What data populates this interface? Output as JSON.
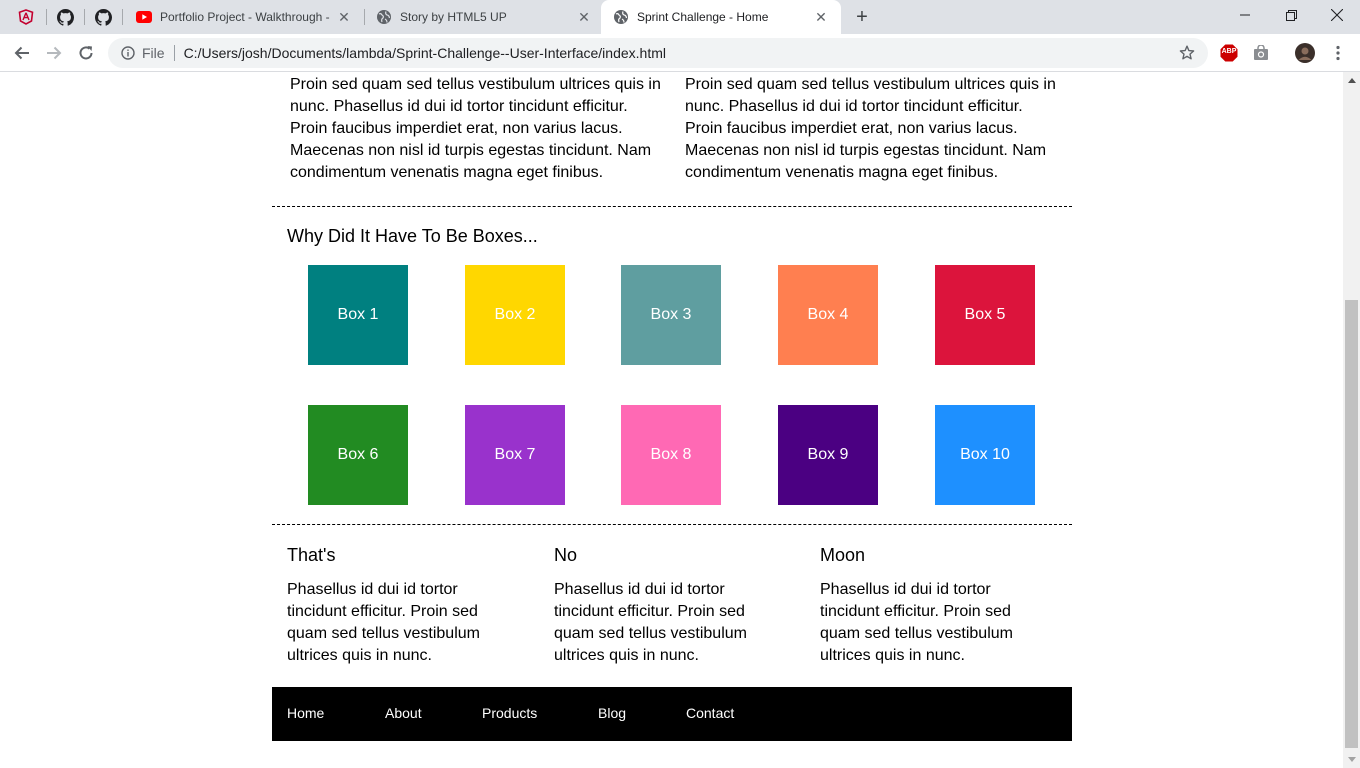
{
  "browser": {
    "tabs": [
      {
        "title": "Portfolio Project - Walkthrough -",
        "favicon": "youtube-icon"
      },
      {
        "title": "Story by HTML5 UP",
        "favicon": "globe-icon"
      },
      {
        "title": "Sprint Challenge - Home",
        "favicon": "globe-icon",
        "active": true
      }
    ],
    "pinned_tabs": [
      "angular-icon",
      "github-icon",
      "github-icon"
    ],
    "address": {
      "scheme_label": "File",
      "url": "C:/Users/josh/Documents/lambda/Sprint-Challenge--User-Interface/index.html"
    },
    "extensions": {
      "adblock_label": "ABP"
    }
  },
  "page": {
    "top_columns": [
      {
        "text": "Proin sed quam sed tellus vestibulum ultrices quis in nunc. Phasellus id dui id tortor tincidunt efficitur. Proin faucibus imperdiet erat, non varius lacus. Maecenas non nisl id turpis egestas tincidunt. Nam condimentum venenatis magna eget finibus."
      },
      {
        "text": "Proin sed quam sed tellus vestibulum ultrices quis in nunc. Phasellus id dui id tortor tincidunt efficitur. Proin faucibus imperdiet erat, non varius lacus. Maecenas non nisl id turpis egestas tincidunt. Nam condimentum venenatis magna eget finibus."
      }
    ],
    "boxes_section": {
      "title": "Why Did It Have To Be Boxes...",
      "boxes": [
        {
          "label": "Box 1",
          "color": "#008080"
        },
        {
          "label": "Box 2",
          "color": "#FFD700"
        },
        {
          "label": "Box 3",
          "color": "#5F9EA0"
        },
        {
          "label": "Box 4",
          "color": "#FF7F50"
        },
        {
          "label": "Box 5",
          "color": "#DC143C"
        },
        {
          "label": "Box 6",
          "color": "#228B22"
        },
        {
          "label": "Box 7",
          "color": "#9932CC"
        },
        {
          "label": "Box 8",
          "color": "#FF69B4"
        },
        {
          "label": "Box 9",
          "color": "#4B0082"
        },
        {
          "label": "Box 10",
          "color": "#1E90FF"
        }
      ]
    },
    "bottom_columns": [
      {
        "heading": "That's",
        "text": "Phasellus id dui id tortor tincidunt efficitur. Proin sed quam sed tellus vestibulum ultrices quis in nunc."
      },
      {
        "heading": "No",
        "text": "Phasellus id dui id tortor tincidunt efficitur. Proin sed quam sed tellus vestibulum ultrices quis in nunc."
      },
      {
        "heading": "Moon",
        "text": "Phasellus id dui id tortor tincidunt efficitur. Proin sed quam sed tellus vestibulum ultrices quis in nunc."
      }
    ],
    "footer_nav": [
      "Home",
      "About",
      "Products",
      "Blog",
      "Contact"
    ]
  }
}
